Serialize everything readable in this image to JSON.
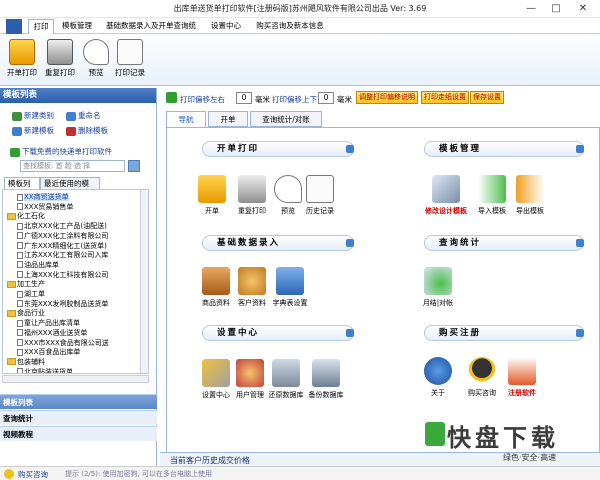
{
  "window": {
    "title": "出库单送货单打印软件[注册码版]苏州飓风软件有限公司出品 Ver: 3.69",
    "minimize": "—",
    "maximize": "□",
    "close": "✕"
  },
  "menu": {
    "tabs": [
      "打印",
      "模板管理",
      "基础数据录入及开单查询统计",
      "设置中心",
      "购买咨询及新本信息"
    ]
  },
  "ribbon": {
    "buttons": [
      "开单打印",
      "重复打印",
      "预览",
      "打印记录"
    ]
  },
  "left": {
    "title": "模板列表",
    "actions": [
      "新建类别",
      "重命名",
      "新建模板",
      "删除模板"
    ],
    "download": "下载免费的快递单打印软件",
    "search_placeholder": "查找模板: 首 超 选 择",
    "tabs": [
      "模板列表",
      "最近使用的模板"
    ],
    "tree": [
      {
        "type": "doc",
        "text": "XX商贸送货单"
      },
      {
        "type": "doc",
        "text": "XXX贸易销售单"
      },
      {
        "type": "folder",
        "text": "化工石化"
      },
      {
        "type": "doc",
        "text": "北京XXX化工产品(油配送)"
      },
      {
        "type": "doc",
        "text": "广德XXX化工涂料有限公司"
      },
      {
        "type": "doc",
        "text": "广东XXX精细化工(送货单)"
      },
      {
        "type": "doc",
        "text": "江苏XXX化工有限公司入库"
      },
      {
        "type": "doc",
        "text": "油品出库单"
      },
      {
        "type": "doc",
        "text": "上海XXX化工科技有限公司"
      },
      {
        "type": "folder",
        "text": "加工生产"
      },
      {
        "type": "doc",
        "text": "湖工单"
      },
      {
        "type": "doc",
        "text": "东莞XXX发咧胶制品送货单"
      },
      {
        "type": "folder",
        "text": "食品行业"
      },
      {
        "type": "doc",
        "text": "童让产品出库清单"
      },
      {
        "type": "doc",
        "text": "福州XXX酒业送货单"
      },
      {
        "type": "doc",
        "text": "XXX市XXX食品有限公司送"
      },
      {
        "type": "doc",
        "text": "XXX百食品出库单"
      },
      {
        "type": "folder",
        "text": "包装辅料"
      },
      {
        "type": "doc",
        "text": "北京贴装送货单"
      }
    ],
    "bottom_nav": [
      "模板列表",
      "查询统计",
      "视频教程"
    ]
  },
  "toolbar": {
    "offset_left_label": "打印偏移左右",
    "offset_left_value": "0",
    "unit1": "毫米",
    "offset_up_label": "打印偏移上下",
    "offset_up_value": "0",
    "unit2": "毫米",
    "btn_help": "调整打印偏移说明",
    "btn_paper": "打印走纸设置",
    "btn_save": "保存设置"
  },
  "content": {
    "tabs": [
      "导航",
      "开单",
      "查询统计/对账"
    ],
    "sections": [
      {
        "title": "开单打印",
        "items": [
          "开单",
          "重复打印",
          "预览",
          "历史记录"
        ]
      },
      {
        "title": "模板管理",
        "items": [
          "修改设计模板",
          "导入模板",
          "导出模板"
        ]
      },
      {
        "title": "基础数据录入",
        "items": [
          "商品资料",
          "客户资料",
          "字典表设置"
        ]
      },
      {
        "title": "查询统计",
        "items": [
          "月结|对帐"
        ]
      },
      {
        "title": "设置中心",
        "items": [
          "设置中心",
          "用户管理",
          "还原数据库",
          "备份数据库"
        ]
      },
      {
        "title": "购买注册",
        "items": [
          "关于",
          "购买咨询",
          "注册软件"
        ]
      }
    ]
  },
  "status": {
    "text": "当前客户历史成交价格"
  },
  "bottombar": {
    "contact": "购买咨询",
    "hint": "提示 (2/5): 使用加密狗, 可以在多台电脑上使用"
  },
  "watermark": {
    "big": "快盘下载",
    "small": "绿色·安全·高速"
  },
  "colors": {
    "accent": "#2b5fae",
    "red_label": "#d00000",
    "yellow_btn": "#ffc21a"
  }
}
